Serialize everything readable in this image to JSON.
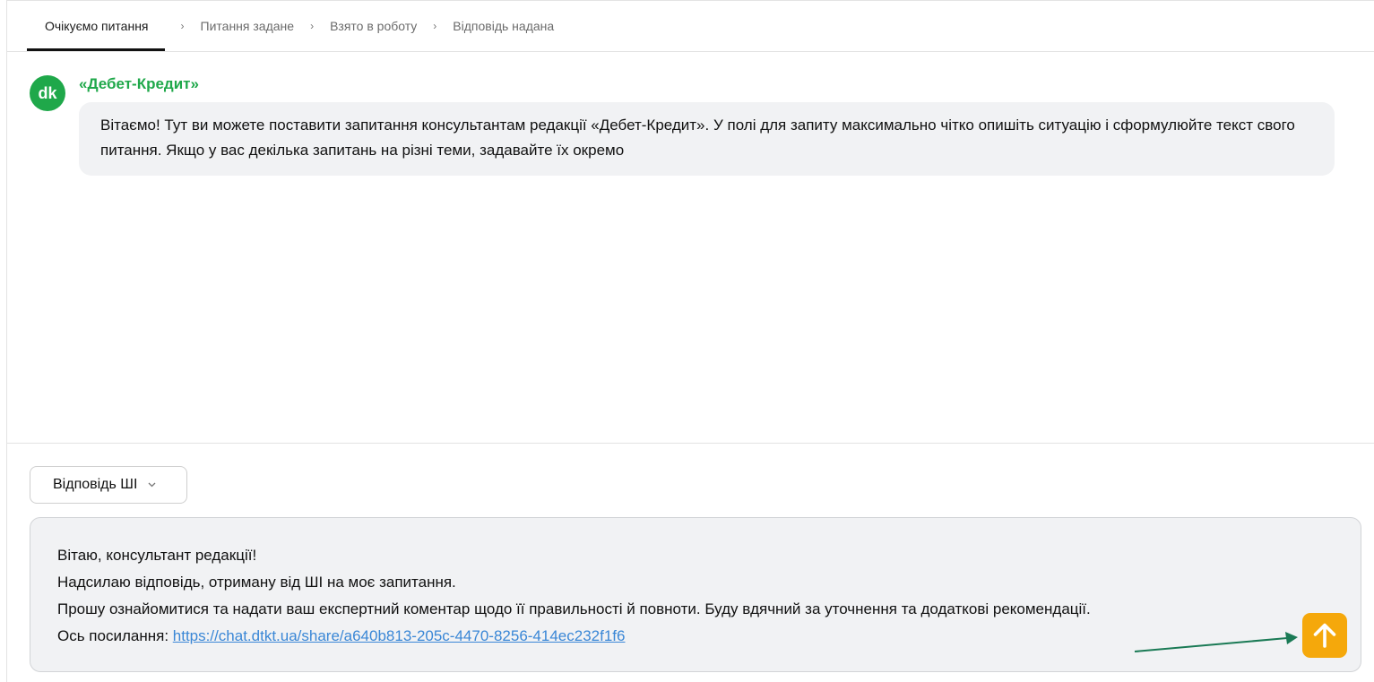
{
  "stepper": {
    "steps": [
      "Очікуємо питання",
      "Питання задане",
      "Взято в роботу",
      "Відповідь надана"
    ],
    "active_index": 0
  },
  "message": {
    "avatar_text": "dk",
    "sender": "«Дебет-Кредит»",
    "text": "Вітаємо! Тут ви можете поставити запитання консультантам редакції «Дебет-Кредит». У полі для запиту максимально чітко опишіть ситуацію і сформулюйте текст свого питання. Якщо у вас декілька запитань на різні теми, задавайте їх окремо"
  },
  "composer": {
    "mode_select": "Відповідь ШІ",
    "lines": [
      "Вітаю, консультант редакції!",
      "Надсилаю відповідь, отриману від ШІ на моє запитання.",
      "Прошу ознайомитися та надати ваш експертний коментар щодо її правильності й повноти. Буду вдячний за уточнення та додаткові рекомендації."
    ],
    "link_prefix": "Ось посилання: ",
    "link_text": "https://chat.dtkt.ua/share/a640b813-205c-4470-8256-414ec232f1f6"
  },
  "icons": {
    "send": "arrow-up-icon",
    "dropdown": "chevron-down-icon",
    "breadcrumb_separator": "chevron-right-icon"
  },
  "colors": {
    "brand_green": "#1fa84a",
    "send_button": "#f5a80b",
    "link": "#3a87d6",
    "annotation_arrow": "#1a7a55"
  }
}
